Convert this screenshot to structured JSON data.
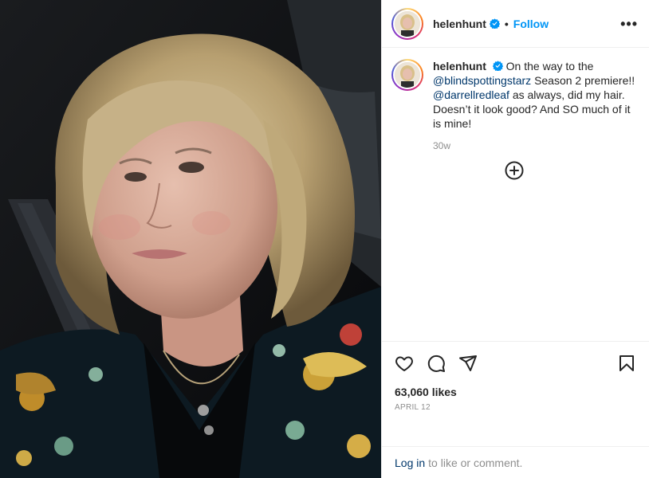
{
  "post": {
    "username": "helenhunt",
    "follow_label": "Follow",
    "more_label": "•••",
    "separator": "•"
  },
  "caption": {
    "username": "helenhunt",
    "part1": "On the way to the",
    "mention1": "@blindspottingstarz",
    "part2": "Season 2 premiere!!",
    "mention2": "@darrellredleaf",
    "part3": "as always, did my hair. Doesn’t it look good? And SO much of it is mine!",
    "time": "30w"
  },
  "stats": {
    "likes": "63,060 likes",
    "date": "APRIL 12"
  },
  "login": {
    "link": "Log in",
    "rest": "to like or comment."
  },
  "icons": {
    "verified": "verified-badge-icon",
    "load_more": "plus-circle-icon",
    "like": "heart-icon",
    "comment": "comment-icon",
    "share": "paper-plane-icon",
    "save": "bookmark-icon"
  },
  "colors": {
    "accent": "#0095f6",
    "mention": "#00376b",
    "muted": "#8e8e8e",
    "text": "#262626"
  }
}
